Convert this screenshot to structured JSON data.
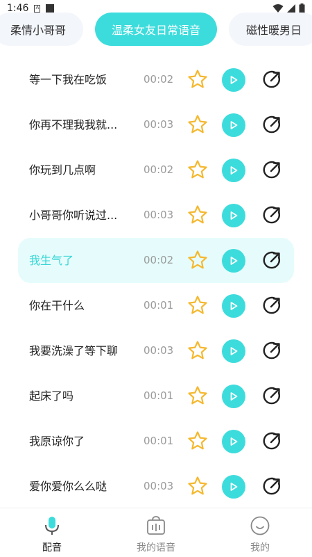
{
  "status_bar": {
    "time": "1:46"
  },
  "tabs": [
    {
      "label": "柔情小哥哥"
    },
    {
      "label": "温柔女友日常语音"
    },
    {
      "label": "磁性暖男日"
    }
  ],
  "items": [
    {
      "title": "等一下我在吃饭",
      "duration": "00:02"
    },
    {
      "title": "你再不理我我就...",
      "duration": "00:03"
    },
    {
      "title": "你玩到几点啊",
      "duration": "00:02"
    },
    {
      "title": "小哥哥你听说过...",
      "duration": "00:03"
    },
    {
      "title": "我生气了",
      "duration": "00:02"
    },
    {
      "title": "你在干什么",
      "duration": "00:01"
    },
    {
      "title": "我要洗澡了等下聊",
      "duration": "00:03"
    },
    {
      "title": "起床了吗",
      "duration": "00:01"
    },
    {
      "title": "我原谅你了",
      "duration": "00:01"
    },
    {
      "title": "爱你爱你么么哒",
      "duration": "00:03"
    }
  ],
  "bottom_nav": [
    {
      "label": "配音",
      "icon": "microphone-icon"
    },
    {
      "label": "我的语音",
      "icon": "voice-bag-icon"
    },
    {
      "label": "我的",
      "icon": "smiley-icon"
    }
  ],
  "colors": {
    "accent": "#3ddcdc",
    "star": "#f5b82e",
    "highlight_bg": "#e6fcfc"
  }
}
